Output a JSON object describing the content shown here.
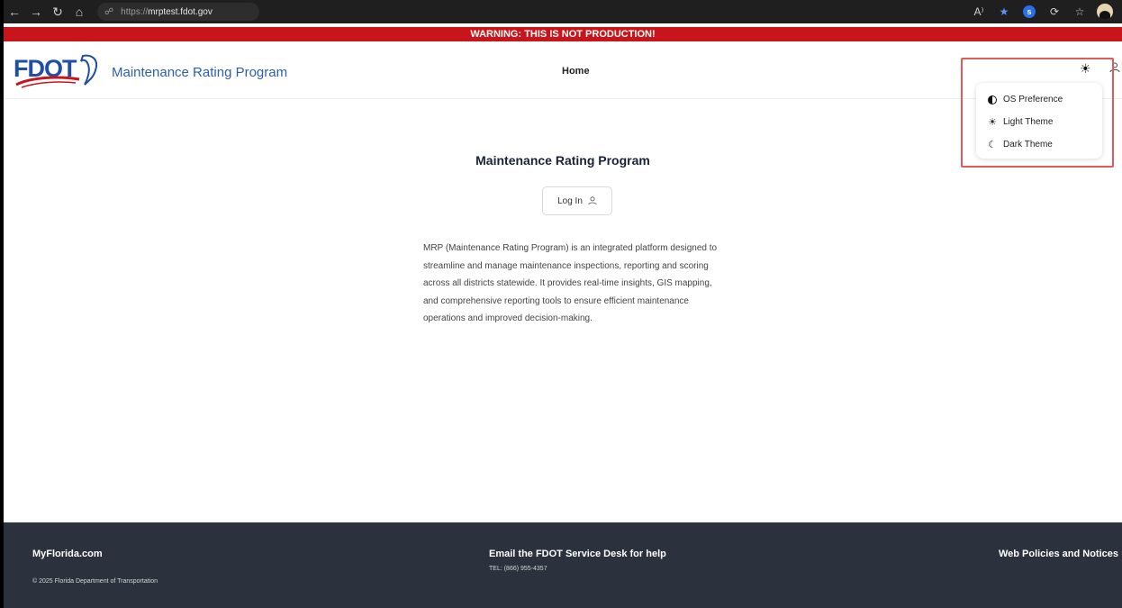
{
  "browser": {
    "url_prefix": "https://",
    "url_host": "mrptest.fdot.gov",
    "read_aloud_label": "A⁾",
    "extension_badge": "s"
  },
  "banner": {
    "text": "WARNING: THIS IS NOT PRODUCTION!"
  },
  "header": {
    "logo_text": "FDOT",
    "site_title": "Maintenance Rating Program",
    "nav": {
      "home": "Home"
    },
    "theme_toggle_glyph": "☀"
  },
  "theme_menu": {
    "items": [
      {
        "label": "OS Preference",
        "icon": "half-circle-icon"
      },
      {
        "label": "Light Theme",
        "icon": "sun-icon"
      },
      {
        "label": "Dark Theme",
        "icon": "moon-icon"
      }
    ]
  },
  "main": {
    "title": "Maintenance Rating Program",
    "login_label": "Log In",
    "description": "MRP (Maintenance Rating Program) is an integrated platform designed to streamline and manage maintenance inspections, reporting and scoring across all districts statewide. It provides real-time insights, GIS mapping, and comprehensive reporting tools to ensure efficient maintenance operations and improved decision-making."
  },
  "footer": {
    "myflorida": "MyFlorida.com",
    "copyright": "© 2025 Florida Department of Transportation",
    "help": "Email the FDOT Service Desk for help",
    "tel": "TEL: (866) 955-4357",
    "policies": "Web Policies and Notices"
  },
  "colors": {
    "banner": "#c8151b",
    "brand_blue": "#2b5fb0",
    "footer_bg": "#2b323d",
    "highlight": "#e35a5a"
  }
}
